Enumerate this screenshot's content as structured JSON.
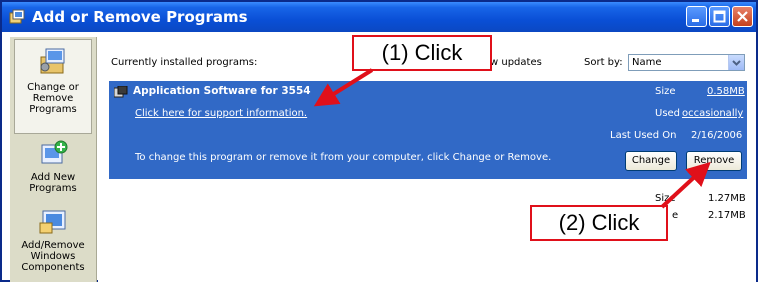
{
  "window": {
    "title": "Add or Remove Programs"
  },
  "sidebar": {
    "items": [
      {
        "label_line1": "Change or",
        "label_line2": "Remove",
        "label_line3": "Programs",
        "icon": "change-remove-programs-icon",
        "selected": true
      },
      {
        "label_line1": "Add New",
        "label_line2": "Programs",
        "icon": "add-new-programs-icon",
        "selected": false
      },
      {
        "label_line1": "Add/Remove",
        "label_line2": "Windows",
        "label_line3": "Components",
        "icon": "add-remove-windows-components-icon",
        "selected": false
      }
    ]
  },
  "header": {
    "installed_label": "Currently installed programs:",
    "updates_label": "w updates",
    "sort_by_label": "Sort by:",
    "sort_by_value": "Name"
  },
  "selected_program": {
    "name": "Application Software for 3554",
    "support_link": "Click here for support information.",
    "change_hint": "To change this program or remove it from your computer, click Change or Remove.",
    "size_label": "Size",
    "size_value": "0.58MB",
    "used_label": "Used",
    "used_value": "occasionally",
    "last_used_label": "Last Used On",
    "last_used_value": "2/16/2006",
    "change_button": "Change",
    "remove_button": "Remove"
  },
  "other_programs": [
    {
      "size_label": "Size",
      "size_value": "1.27MB"
    },
    {
      "size_label": "e",
      "size_value": "2.17MB"
    }
  ],
  "annotations": {
    "click1": "(1) Click",
    "click2": "(2) Click",
    "color": "#e0101a"
  },
  "colors": {
    "titlebar": "#0a4fd6",
    "selection": "#3169c6",
    "sidebar": "#dcdcc8"
  }
}
